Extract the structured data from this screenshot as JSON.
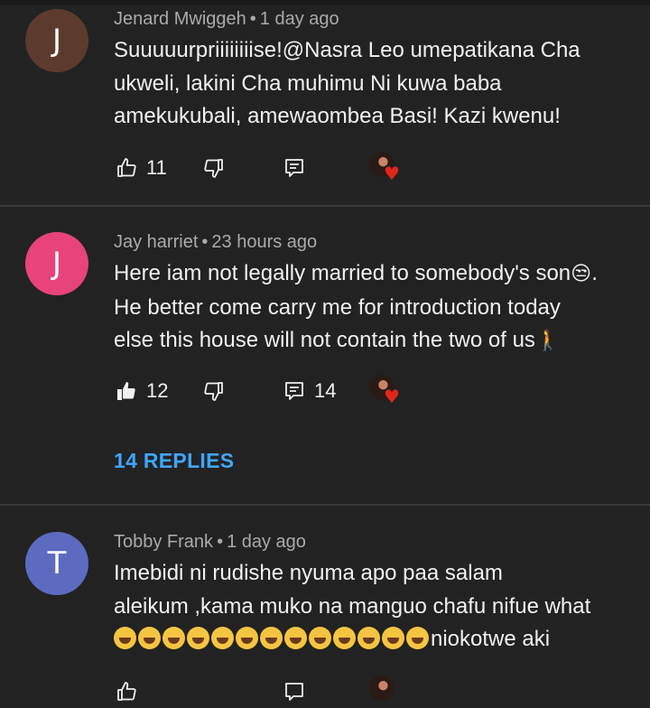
{
  "comments": [
    {
      "avatar_letter": "J",
      "avatar_color": "#5d3a2e",
      "author": "Jenard Mwiggeh",
      "separator": "•",
      "time": "1 day ago",
      "lines": [
        "Suuuuurpriiiiiiiise!@Nasra Leo umepatikana Cha",
        "ukweli, lakini Cha muhimu Ni kuwa baba",
        "amekukubali, amewaombea Basi! Kazi kwenu!"
      ],
      "likes": "11",
      "liked": false,
      "reply_count": ""
    },
    {
      "avatar_letter": "J",
      "avatar_color": "#e8437a",
      "author": "Jay harriet",
      "separator": "•",
      "time": "23 hours ago",
      "lines": [
        "Here iam not legally married to somebody's son",
        "He better  come carry me for introduction today",
        "else this house will not contain the two of us"
      ],
      "line1_emoji": "😒.",
      "line3_emoji": "🚶",
      "likes": "12",
      "liked": true,
      "reply_count": "14",
      "replies_label": "14 REPLIES"
    },
    {
      "avatar_letter": "T",
      "avatar_color": "#5c6bc0",
      "author": "Tobby Frank",
      "separator": "•",
      "time": "1 day ago",
      "lines": [
        "Imebidi ni rudishe nyuma apo paa salam",
        "aleikum ,kama muko na manguo chafu nifue what",
        "niokotwe aki"
      ],
      "laugh_emoji_count": 13
    }
  ],
  "icons": {
    "like": "thumbs-up-icon",
    "dislike": "thumbs-down-icon",
    "reply": "reply-icon",
    "creator_heart": "creator-heart-icon",
    "more": "more-vert-icon"
  },
  "colors": {
    "background": "#222222",
    "divider": "#3a3a3a",
    "meta_text": "#aaaaaa",
    "body_text": "#f1f1f1",
    "link": "#3ea6ff",
    "heart": "#e0261b"
  }
}
